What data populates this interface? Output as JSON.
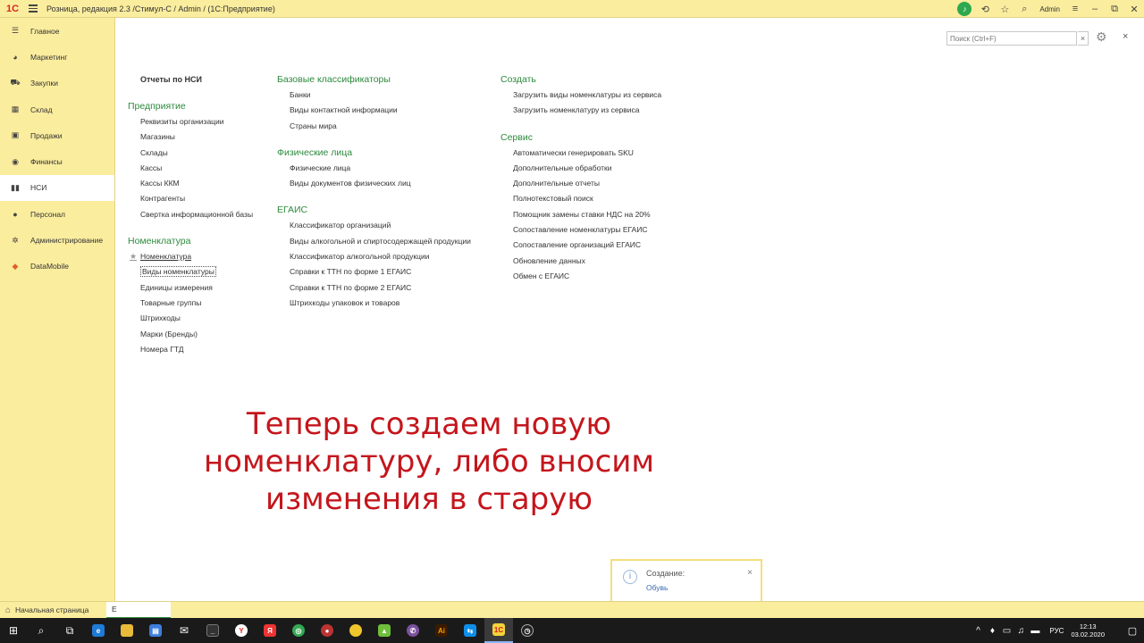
{
  "titlebar": {
    "logo": "1С",
    "title": "Розница, редакция 2.3 /Стимул-С / Admin /  (1С:Предприятие)",
    "user": "Admin"
  },
  "sidebar": {
    "items": [
      {
        "label": "Главное",
        "icon": "menu-lines-icon",
        "glyph": "☰"
      },
      {
        "label": "Маркетинг",
        "icon": "pie-chart-icon",
        "glyph": "◕"
      },
      {
        "label": "Закупки",
        "icon": "cart-icon",
        "glyph": "⛟"
      },
      {
        "label": "Склад",
        "icon": "grid-icon",
        "glyph": "▦"
      },
      {
        "label": "Продажи",
        "icon": "gift-box-icon",
        "glyph": "▣"
      },
      {
        "label": "Финансы",
        "icon": "coins-icon",
        "glyph": "◉"
      },
      {
        "label": "НСИ",
        "icon": "books-icon",
        "glyph": "▮▮"
      },
      {
        "label": "Персонал",
        "icon": "person-icon",
        "glyph": "●"
      },
      {
        "label": "Администрирование",
        "icon": "gear-icon",
        "glyph": "✲"
      },
      {
        "label": "DataMobile",
        "icon": "datamobile-icon",
        "glyph": "◆"
      }
    ],
    "active_index": 6
  },
  "search": {
    "placeholder": "Поиск (Ctrl+F)"
  },
  "columns": {
    "col1": {
      "reports": "Отчеты по НСИ",
      "enterprise": {
        "title": "Предприятие",
        "links": [
          "Реквизиты организации",
          "Магазины",
          "Склады",
          "Кассы",
          "Кассы ККМ",
          "Контрагенты",
          "Свертка информационной базы"
        ]
      },
      "nomenclature": {
        "title": "Номенклатура",
        "links": [
          "Номенклатура",
          "Виды номенклатуры",
          "Единицы измерения",
          "Товарные группы",
          "Штрихкоды",
          "Марки (Бренды)",
          "Номера ГТД"
        ]
      }
    },
    "col2": {
      "base": {
        "title": "Базовые классификаторы",
        "links": [
          "Банки",
          "Виды контактной информации",
          "Страны мира"
        ]
      },
      "persons": {
        "title": "Физические лица",
        "links": [
          "Физические лица",
          "Виды документов физических лиц"
        ]
      },
      "egais": {
        "title": "ЕГАИС",
        "links": [
          "Классификатор организаций",
          "Виды алкогольной и спиртосодержащей продукции",
          "Классификатор алкогольной продукции",
          "Справки к ТТН по форме 1 ЕГАИС",
          "Справки к ТТН по форме 2 ЕГАИС",
          "Штрихкоды упаковок и товаров"
        ]
      }
    },
    "col3": {
      "create": {
        "title": "Создать",
        "links": [
          "Загрузить виды номенклатуры из сервиса",
          "Загрузить номенклатуру из сервиса"
        ]
      },
      "service": {
        "title": "Сервис",
        "links": [
          "Автоматически генерировать SKU",
          "Дополнительные обработки",
          "Дополнительные отчеты",
          "Полнотекстовый поиск",
          "Помощник замены ставки НДС на 20%",
          "Сопоставление номенклатуры ЕГАИС",
          "Сопоставление организаций ЕГАИС",
          "Обновление данных",
          "Обмен с ЕГАИС"
        ]
      }
    }
  },
  "caption": {
    "line1": "Теперь создаем новую",
    "line2": "номенклатуру, либо вносим",
    "line3": "изменения в старую"
  },
  "notification": {
    "title": "Создание:",
    "link": "Обувь"
  },
  "bottom_tabs": {
    "home": "Начальная страница",
    "second": "Е"
  },
  "taskbar": {
    "lang": "РУС",
    "time": "12:13",
    "date": "03.02.2020"
  },
  "colors": {
    "panel": "#fbed9e",
    "group_title": "#2c8a3c",
    "caption": "#c4161c"
  }
}
